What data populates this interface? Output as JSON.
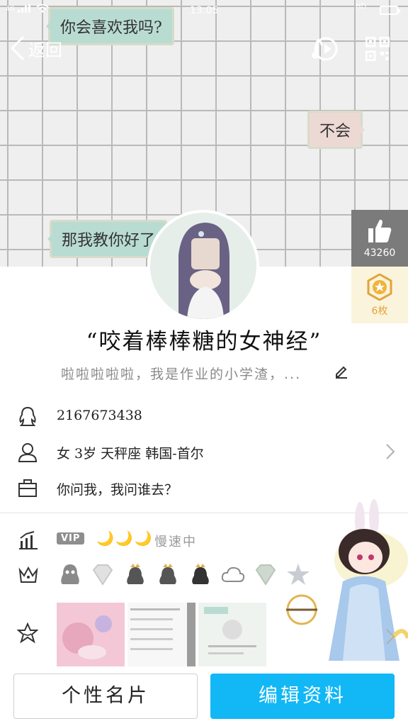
{
  "status_bar": {
    "signal_text": "4G",
    "time": "13:05",
    "hd": "HD"
  },
  "header": {
    "back_label": "返回"
  },
  "cover": {
    "bubble_1": "你会喜欢我吗?",
    "bubble_2": "不会",
    "bubble_3": "那我教你好了"
  },
  "like": {
    "count": "43260"
  },
  "medal": {
    "count": "6枚"
  },
  "profile": {
    "nickname": "“咬着棒棒糖的女神经”",
    "signature": "啦啦啦啦啦，我是作业的小学渣，..."
  },
  "info": {
    "qq_number": "2167673438",
    "details": "女  3岁  天秤座  韩国-首尔",
    "bio": "你问我，我问谁去？"
  },
  "level": {
    "vip_label": "VIP",
    "moons": "🌙🌙🌙",
    "status": "慢速中"
  },
  "buttons": {
    "card": "个性名片",
    "edit": "编辑资料"
  },
  "colors": {
    "accent": "#12b7f5",
    "like_bg": "#7b7b7b",
    "medal_bg": "#fbf4dc",
    "medal_text": "#e3a33a"
  }
}
